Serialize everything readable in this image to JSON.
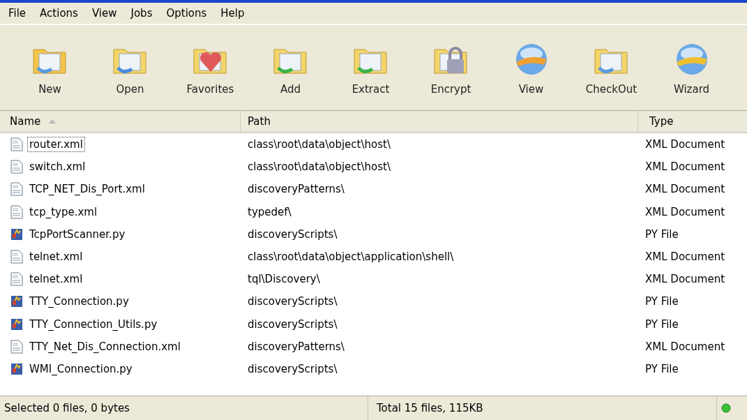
{
  "menu": [
    "File",
    "Actions",
    "View",
    "Jobs",
    "Options",
    "Help"
  ],
  "toolbar": [
    {
      "label": "New",
      "kind": "new"
    },
    {
      "label": "Open",
      "kind": "open"
    },
    {
      "label": "Favorites",
      "kind": "favorites"
    },
    {
      "label": "Add",
      "kind": "add"
    },
    {
      "label": "Extract",
      "kind": "extract"
    },
    {
      "label": "Encrypt",
      "kind": "encrypt"
    },
    {
      "label": "View",
      "kind": "view"
    },
    {
      "label": "CheckOut",
      "kind": "checkout"
    },
    {
      "label": "Wizard",
      "kind": "wizard"
    }
  ],
  "columns": [
    {
      "label": "Name",
      "sorted": true
    },
    {
      "label": "Path",
      "sorted": false
    },
    {
      "label": "Type",
      "sorted": false
    }
  ],
  "rows": [
    {
      "name": "router.xml",
      "path": "class\\root\\data\\object\\host\\",
      "type": "XML Document",
      "kind": "xml",
      "focused": true
    },
    {
      "name": "switch.xml",
      "path": "class\\root\\data\\object\\host\\",
      "type": "XML Document",
      "kind": "xml",
      "focused": false
    },
    {
      "name": "TCP_NET_Dis_Port.xml",
      "path": "discoveryPatterns\\",
      "type": "XML Document",
      "kind": "xml",
      "focused": false
    },
    {
      "name": "tcp_type.xml",
      "path": "typedef\\",
      "type": "XML Document",
      "kind": "xml",
      "focused": false
    },
    {
      "name": "TcpPortScanner.py",
      "path": "discoveryScripts\\",
      "type": "PY File",
      "kind": "py",
      "focused": false
    },
    {
      "name": "telnet.xml",
      "path": "class\\root\\data\\object\\application\\shell\\",
      "type": "XML Document",
      "kind": "xml",
      "focused": false
    },
    {
      "name": "telnet.xml",
      "path": "tql\\Discovery\\",
      "type": "XML Document",
      "kind": "xml",
      "focused": false
    },
    {
      "name": "TTY_Connection.py",
      "path": "discoveryScripts\\",
      "type": "PY File",
      "kind": "py",
      "focused": false
    },
    {
      "name": "TTY_Connection_Utils.py",
      "path": "discoveryScripts\\",
      "type": "PY File",
      "kind": "py",
      "focused": false
    },
    {
      "name": "TTY_Net_Dis_Connection.xml",
      "path": "discoveryPatterns\\",
      "type": "XML Document",
      "kind": "xml",
      "focused": false
    },
    {
      "name": "WMI_Connection.py",
      "path": "discoveryScripts\\",
      "type": "PY File",
      "kind": "py",
      "focused": false
    }
  ],
  "status_bar": {
    "selection": "Selected 0 files, 0 bytes",
    "total": "Total 15 files, 115KB"
  }
}
